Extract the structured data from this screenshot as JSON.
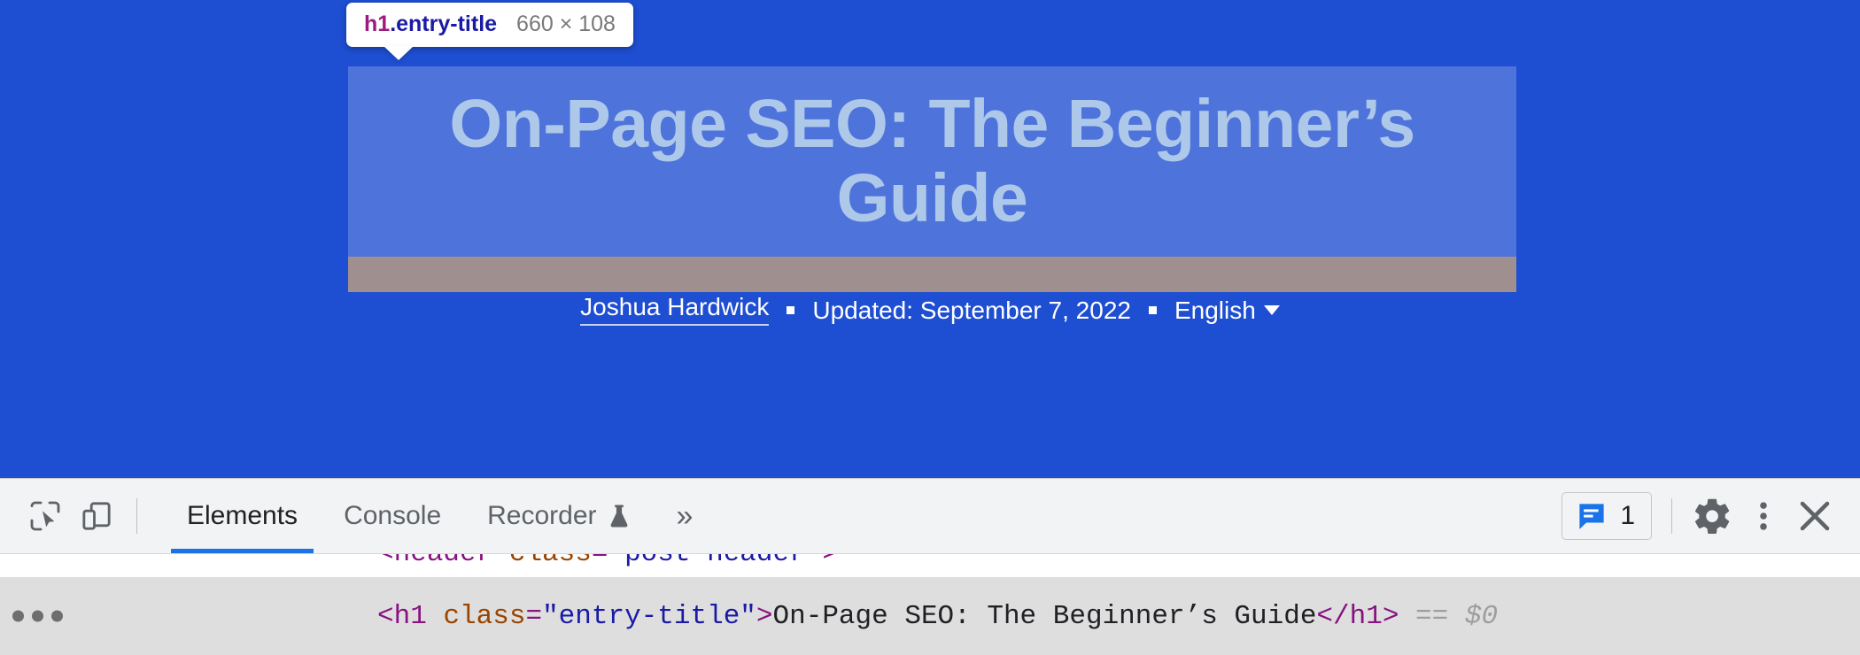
{
  "page": {
    "background_color": "#1e4ed1",
    "title": "On-Page SEO: The Beginner’s Guide",
    "title_color": "#aec8ea",
    "byline": {
      "author": "Joshua Hardwick",
      "separator": "▪",
      "updated": "Updated: September 7, 2022",
      "language": "English",
      "language_caret": "▾"
    }
  },
  "inspector_tooltip": {
    "tag": "h1",
    "class_selector": ".entry-title",
    "dimensions": "660 × 108",
    "tag_color": "#9c1c7e",
    "class_color": "#1a1aa6",
    "dimension_color": "#797979"
  },
  "highlight": {
    "content_overlay_color": "rgba(255,255,255,0.215)",
    "margin_band_color": "#9f8f8f"
  },
  "devtools": {
    "toolbar": {
      "inspect_icon_title": "Inspect element",
      "device_toolbar_icon_title": "Toggle device toolbar",
      "tabs": [
        {
          "label": "Elements",
          "active": true,
          "icon": ""
        },
        {
          "label": "Console",
          "active": false,
          "icon": ""
        },
        {
          "label": "Recorder",
          "active": false,
          "icon": "flask-icon"
        }
      ],
      "more_tabs": "»",
      "issues": {
        "count": "1",
        "icon": "message-icon",
        "icon_color": "#1a73e8"
      },
      "settings_icon_title": "Settings",
      "kebab_icon_title": "Customize and control DevTools",
      "close_icon_title": "Close DevTools",
      "accent_color": "#1a73e8"
    },
    "dom": {
      "clipped_line": {
        "lt": "<",
        "tag": "header",
        "space": " ",
        "attr": "class",
        "eq": "=",
        "value": "\"post-header\"",
        "gt": ">"
      },
      "selected_line": {
        "ellipsis": "•••",
        "lt": "<",
        "tag": "h1",
        "space": " ",
        "attr": "class",
        "eq": "=",
        "value": "\"entry-title\"",
        "gt": ">",
        "text": "On-Page SEO: The Beginner’s Guide",
        "close_tag": "</h1>",
        "equals_marker": "==",
        "dollar_ref": "$0"
      },
      "selected_row_color": "#dedede"
    }
  }
}
